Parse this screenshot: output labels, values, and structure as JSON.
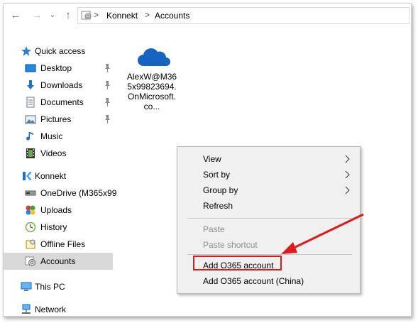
{
  "breadcrumb": {
    "items": [
      "Konnekt",
      "Accounts"
    ],
    "separator": ">"
  },
  "sidebar": {
    "items": [
      {
        "label": "Quick access",
        "icon": "star-icon"
      },
      {
        "label": "Desktop",
        "icon": "desktop-icon",
        "pinned": true
      },
      {
        "label": "Downloads",
        "icon": "download-icon",
        "pinned": true
      },
      {
        "label": "Documents",
        "icon": "documents-icon",
        "pinned": true
      },
      {
        "label": "Pictures",
        "icon": "pictures-icon",
        "pinned": true
      },
      {
        "label": "Music",
        "icon": "music-icon"
      },
      {
        "label": "Videos",
        "icon": "videos-icon"
      },
      {
        "label": "Konnekt",
        "icon": "konnekt-icon"
      },
      {
        "label": "OneDrive (M365x99",
        "icon": "drive-icon"
      },
      {
        "label": "Uploads",
        "icon": "uploads-icon"
      },
      {
        "label": "History",
        "icon": "history-icon"
      },
      {
        "label": "Offline Files",
        "icon": "offline-files-icon"
      },
      {
        "label": "Accounts",
        "icon": "gear-icon",
        "selected": true
      },
      {
        "label": "This PC",
        "icon": "computer-icon"
      },
      {
        "label": "Network",
        "icon": "network-icon"
      }
    ]
  },
  "content": {
    "file": {
      "label": "AlexW@M365x99823694.OnMicrosoft.co...",
      "icon": "cloud-icon"
    }
  },
  "context_menu": {
    "items": [
      {
        "label": "View",
        "submenu": true
      },
      {
        "label": "Sort by",
        "submenu": true
      },
      {
        "label": "Group by",
        "submenu": true
      },
      {
        "label": "Refresh"
      },
      {
        "label": "Paste",
        "disabled": true
      },
      {
        "label": "Paste shortcut",
        "disabled": true
      },
      {
        "label": "Add O365 account",
        "highlighted": true
      },
      {
        "label": "Add O365 account (China)"
      }
    ]
  },
  "colors": {
    "highlight": "#e01a1a",
    "selection": "#d9d9d9",
    "menu_bg": "#f0f0f0",
    "cloud": "#1565c0"
  }
}
